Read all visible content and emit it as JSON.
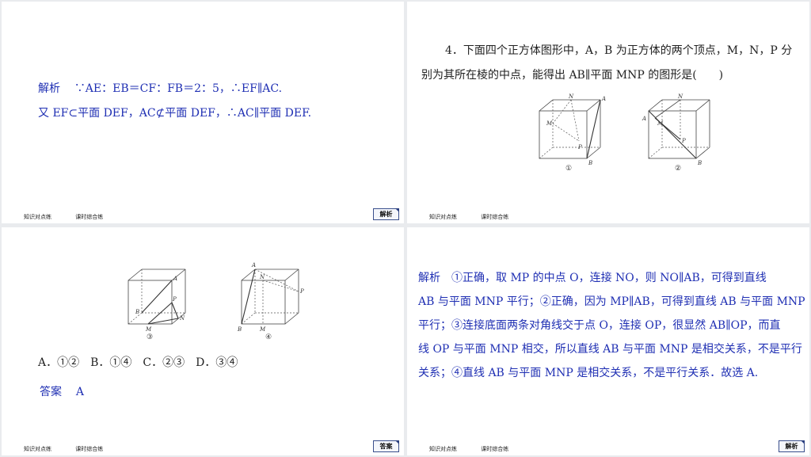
{
  "slide1": {
    "analysis_label": "解析",
    "line1": "∵AE：EB＝CF：FB＝2：5，∴EF∥AC.",
    "line2": "又 EF⊂平面 DEF，AC⊄平面 DEF，∴AC∥平面 DEF.",
    "tag": "解析"
  },
  "slide2": {
    "q_line1": "4．下面四个正方体图形中，A，B 为正方体的两个顶点，M，N，P 分",
    "q_line2": "别为其所在棱的中点，能得出 AB∥平面 MNP 的图形是(　　)",
    "fig1_caption": "①",
    "fig2_caption": "②"
  },
  "slide3": {
    "fig3_caption": "③",
    "fig4_caption": "④",
    "options": "A．①②　B．①④　C．②③　D．③④",
    "answer_label": "答案",
    "answer_value": "A",
    "tag": "答案"
  },
  "slide4": {
    "lines": [
      "解析　①正确，取 MP 的中点 O，连接 NO，则 NO∥AB，可得到直线",
      "AB 与平面 MNP 平行；②正确，因为 MP∥AB，可得到直线 AB 与平面 MNP",
      "平行；③连接底面两条对角线交于点 O，连接 OP，很显然 AB∥OP，而直",
      "线 OP 与平面 MNP 相交，所以直线 AB 与平面 MNP 是相交关系，不是平行",
      "关系；④直线 AB 与平面 MNP 是相交关系，不是平行关系．故选 A."
    ],
    "tag": "解析"
  },
  "footer": {
    "link1": "知识对点练",
    "link2": "课时综合练"
  },
  "labels": {
    "A": "A",
    "B": "B",
    "M": "M",
    "N": "N",
    "P": "P"
  },
  "colors": {
    "text_blue": "#1f2fb3",
    "tag_border": "#3a4f8c"
  }
}
